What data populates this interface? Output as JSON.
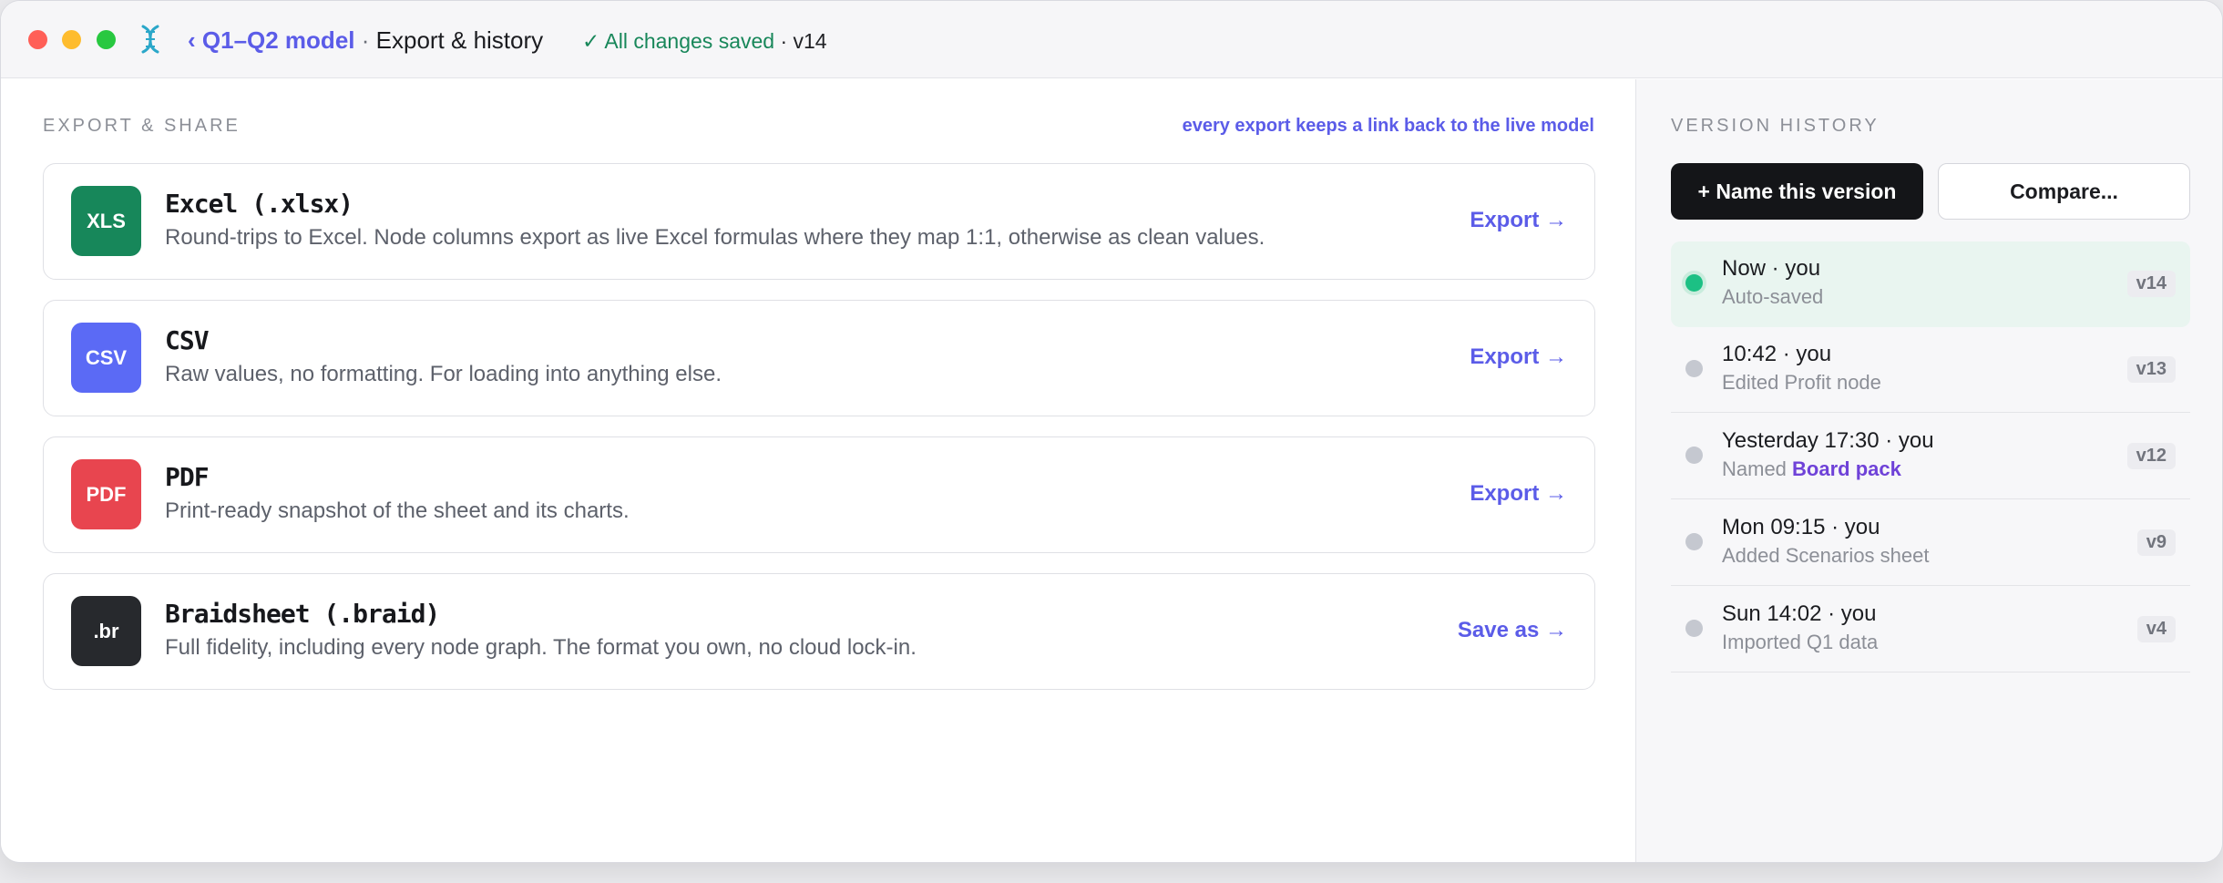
{
  "titlebar": {
    "back_label": "‹ Q1–Q2 model",
    "separator": "·",
    "current_page": "Export & history",
    "save_status": "✓ All changes saved",
    "version_suffix": "· v14"
  },
  "export": {
    "section_label": "EXPORT & SHARE",
    "hint": "every export keeps a link back to the live model",
    "options": [
      {
        "badge": "XLS",
        "badge_color": "#17875a",
        "title": "Excel (.xlsx)",
        "description": "Round-trips to Excel. Node columns export as live Excel formulas where they map 1:1, otherwise as clean values.",
        "action": "Export →"
      },
      {
        "badge": "CSV",
        "badge_color": "#5b6af5",
        "title": "CSV",
        "description": "Raw values, no formatting. For loading into anything else.",
        "action": "Export →"
      },
      {
        "badge": "PDF",
        "badge_color": "#e8454f",
        "title": "PDF",
        "description": "Print-ready snapshot of the sheet and its charts.",
        "action": "Export →"
      },
      {
        "badge": ".br",
        "badge_color": "#27292d",
        "title": "Braidsheet (.braid)",
        "description": "Full fidelity, including every node graph. The format you own, no cloud lock-in.",
        "action": "Save as →"
      }
    ]
  },
  "history": {
    "section_label": "VERSION HISTORY",
    "name_version_label": "+ Name this version",
    "compare_label": "Compare...",
    "entries": [
      {
        "when": "Now · you",
        "what": "Auto-saved",
        "named": "",
        "version": "v14",
        "active": true
      },
      {
        "when": "10:42 · you",
        "what": "Edited Profit node",
        "named": "",
        "version": "v13",
        "active": false
      },
      {
        "when": "Yesterday 17:30 · you",
        "what": "Named ",
        "named": "Board pack",
        "version": "v12",
        "active": false
      },
      {
        "when": "Mon 09:15 · you",
        "what": "Added Scenarios sheet",
        "named": "",
        "version": "v9",
        "active": false
      },
      {
        "when": "Sun 14:02 · you",
        "what": "Imported Q1 data",
        "named": "",
        "version": "v4",
        "active": false
      }
    ]
  },
  "icons": {
    "app": "dna-helix-icon"
  }
}
